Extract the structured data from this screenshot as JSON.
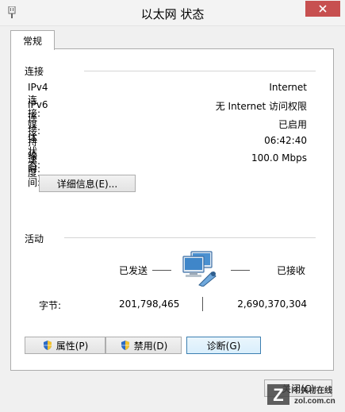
{
  "window": {
    "title": "以太网 状态"
  },
  "tabs": [
    {
      "label": "常规"
    }
  ],
  "connection": {
    "section_label": "连接",
    "rows": [
      {
        "label": "IPv4 连接:",
        "value": "Internet"
      },
      {
        "label": "IPv6 连接:",
        "value": "无 Internet 访问权限"
      },
      {
        "label": "媒体状态:",
        "value": "已启用"
      },
      {
        "label": "持续时间:",
        "value": "06:42:40"
      },
      {
        "label": "速度:",
        "value": "100.0 Mbps"
      }
    ],
    "details_button": "详细信息(E)..."
  },
  "activity": {
    "section_label": "活动",
    "sent_label": "已发送",
    "received_label": "已接收",
    "bytes_label": "字节:",
    "bytes_sent": "201,798,465",
    "bytes_received": "2,690,370,304"
  },
  "actions": {
    "properties": "属性(P)",
    "disable": "禁用(D)",
    "diagnose": "诊断(G)"
  },
  "footer": {
    "close": "关闭(C)"
  },
  "watermark": {
    "line1": "中关村在线",
    "line2": "zol.com.cn"
  },
  "colors": {
    "close_red": "#c75050",
    "accent": "#3c7fb1"
  }
}
